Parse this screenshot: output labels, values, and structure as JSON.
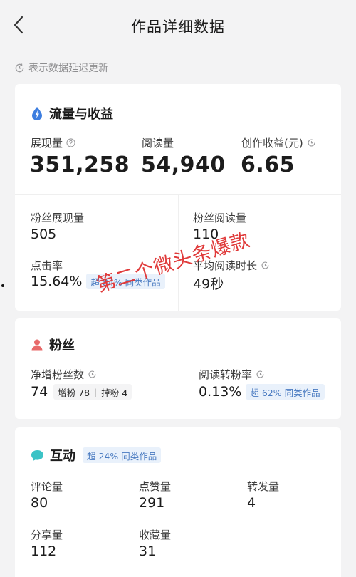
{
  "header": {
    "title": "作品详细数据"
  },
  "notice": "表示数据延迟更新",
  "traffic": {
    "title": "流量与收益",
    "impressions_label": "展现量",
    "impressions_value": "351,258",
    "reads_label": "阅读量",
    "reads_value": "54,940",
    "earnings_label": "创作收益(元)",
    "earnings_value": "6.65",
    "fan_impressions_label": "粉丝展现量",
    "fan_impressions_value": "505",
    "fan_reads_label": "粉丝阅读量",
    "fan_reads_value": "110",
    "ctr_label": "点击率",
    "ctr_value": "15.64%",
    "ctr_badge": "超 84% 同类作品",
    "avg_read_label": "平均阅读时长",
    "avg_read_value": "49秒"
  },
  "fans": {
    "title": "粉丝",
    "net_label": "净增粉丝数",
    "net_value": "74",
    "gain_text": "增粉 78",
    "loss_text": "掉粉 4",
    "conversion_label": "阅读转粉率",
    "conversion_value": "0.13%",
    "conversion_badge": "超 62% 同类作品"
  },
  "interaction": {
    "title": "互动",
    "badge": "超 24% 同类作品",
    "comments_label": "评论量",
    "comments_value": "80",
    "likes_label": "点赞量",
    "likes_value": "291",
    "reposts_label": "转发量",
    "reposts_value": "4",
    "shares_label": "分享量",
    "shares_value": "112",
    "favorites_label": "收藏量",
    "favorites_value": "31"
  },
  "watermark": "第二个微头条爆款",
  "colors": {
    "accent_blue": "#4a7bc1",
    "watermark_red": "#e03a3a",
    "fans_icon": "#e86a6a",
    "interaction_icon": "#3cc3c6",
    "traffic_icon": "#3d7ee0"
  }
}
